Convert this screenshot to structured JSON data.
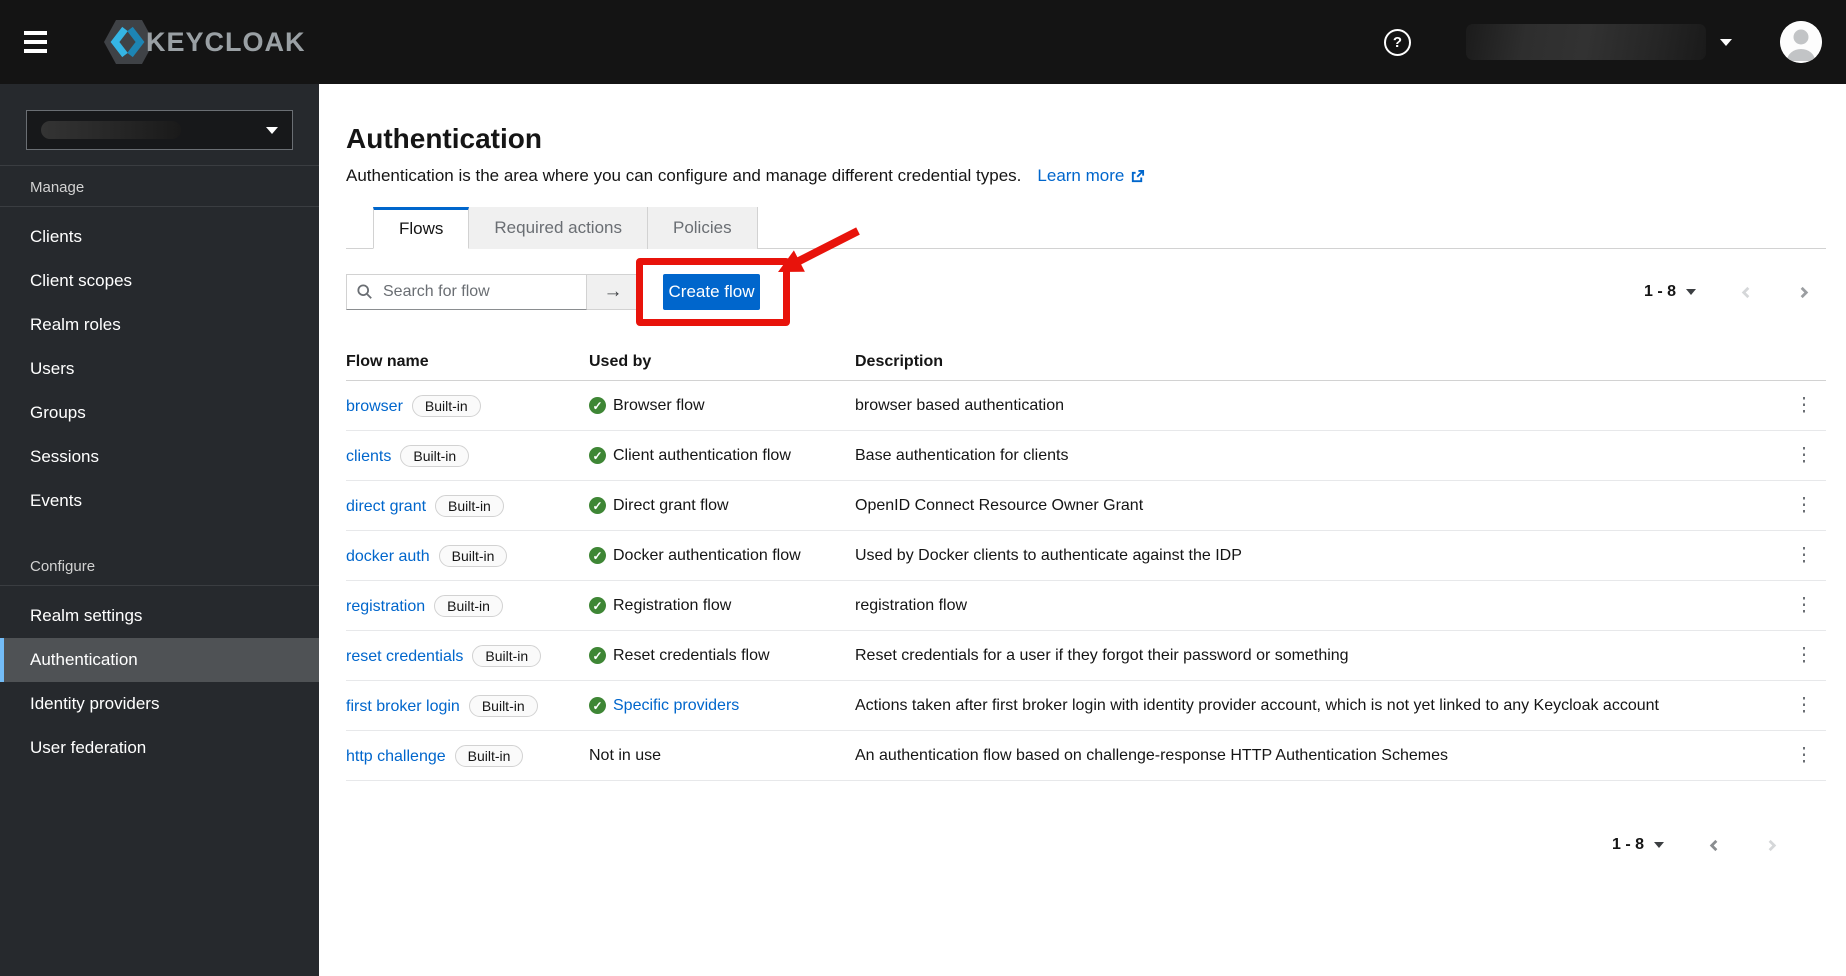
{
  "masthead": {
    "brand": "KEYCLOAK",
    "help_label": "?"
  },
  "sidebar": {
    "sections": [
      {
        "label": "Manage",
        "items": [
          "Clients",
          "Client scopes",
          "Realm roles",
          "Users",
          "Groups",
          "Sessions",
          "Events"
        ]
      },
      {
        "label": "Configure",
        "items": [
          "Realm settings",
          "Authentication",
          "Identity providers",
          "User federation"
        ],
        "active_item": "Authentication"
      }
    ]
  },
  "page": {
    "title": "Authentication",
    "subtitle": "Authentication is the area where you can configure and manage different credential types.",
    "learn_more_label": "Learn more",
    "tabs": [
      {
        "label": "Flows",
        "active": true
      },
      {
        "label": "Required actions",
        "active": false
      },
      {
        "label": "Policies",
        "active": false
      }
    ],
    "toolbar": {
      "search_placeholder": "Search for flow",
      "create_button_label": "Create flow"
    },
    "pagination": {
      "range": "1 - 8"
    }
  },
  "table": {
    "columns": [
      "Flow name",
      "Used by",
      "Description"
    ],
    "badge_label": "Built-in",
    "rows": [
      {
        "name": "browser",
        "used_by": "Browser flow",
        "in_use": true,
        "used_by_link": false,
        "description": "browser based authentication"
      },
      {
        "name": "clients",
        "used_by": "Client authentication flow",
        "in_use": true,
        "used_by_link": false,
        "description": "Base authentication for clients"
      },
      {
        "name": "direct grant",
        "used_by": "Direct grant flow",
        "in_use": true,
        "used_by_link": false,
        "description": "OpenID Connect Resource Owner Grant"
      },
      {
        "name": "docker auth",
        "used_by": "Docker authentication flow",
        "in_use": true,
        "used_by_link": false,
        "description": "Used by Docker clients to authenticate against the IDP"
      },
      {
        "name": "registration",
        "used_by": "Registration flow",
        "in_use": true,
        "used_by_link": false,
        "description": "registration flow"
      },
      {
        "name": "reset credentials",
        "used_by": "Reset credentials flow",
        "in_use": true,
        "used_by_link": false,
        "description": "Reset credentials for a user if they forgot their password or something"
      },
      {
        "name": "first broker login",
        "used_by": "Specific providers",
        "in_use": true,
        "used_by_link": true,
        "description": "Actions taken after first broker login with identity provider account, which is not yet linked to any Keycloak account"
      },
      {
        "name": "http challenge",
        "used_by": "Not in use",
        "in_use": false,
        "used_by_link": false,
        "description": "An authentication flow based on challenge-response HTTP Authentication Schemes"
      }
    ]
  },
  "icons": {
    "kebab": "⋮",
    "search_submit": "→",
    "check": "✓"
  },
  "colors": {
    "accent": "#0066cc",
    "link": "#0066cc",
    "annotation_red": "#e8130b",
    "success_green": "#3e8635",
    "masthead_bg": "#141414",
    "sidebar_bg": "#26292d",
    "active_nav_border": "#73bcf7"
  }
}
